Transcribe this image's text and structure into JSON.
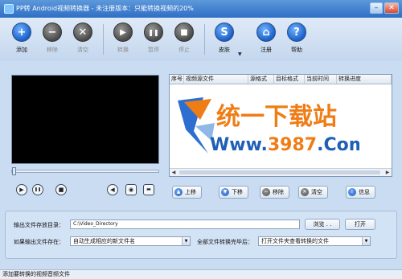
{
  "window": {
    "title": "PP转 Android视频转换器 - 未注册版本：只能转换视频的20%",
    "minimize_glyph": "–",
    "close_glyph": "✕"
  },
  "toolbar": {
    "add": {
      "label": "添加",
      "icon": "plus-icon",
      "glyph": "+"
    },
    "remove": {
      "label": "移除",
      "icon": "minus-icon",
      "glyph": "−"
    },
    "clear": {
      "label": "清空",
      "icon": "x-icon",
      "glyph": "✕"
    },
    "convert": {
      "label": "转换",
      "icon": "play-icon",
      "glyph": "▶"
    },
    "pause": {
      "label": "暂停",
      "icon": "pause-icon",
      "glyph": "❚❚"
    },
    "stop": {
      "label": "停止",
      "icon": "stop-icon",
      "glyph": "■"
    },
    "skin": {
      "label": "皮肤",
      "icon": "skin-s-icon",
      "glyph": "S"
    },
    "register": {
      "label": "注册",
      "icon": "home-icon",
      "glyph": "⌂"
    },
    "help": {
      "label": "帮助",
      "icon": "question-icon",
      "glyph": "?"
    }
  },
  "player": {
    "play_glyph": "▶",
    "pause_glyph": "❚❚",
    "stop_glyph": "■",
    "volume_glyph": "◀",
    "snapshot_glyph": "◉",
    "folder_glyph": "▬"
  },
  "file_list": {
    "columns": [
      "序号",
      "视频源文件",
      "源格式",
      "目标格式",
      "当前时间",
      "转换进度"
    ],
    "rows": [],
    "watermark": {
      "brand": "统一下载站",
      "url_prefix": "Www.",
      "url_number": "3987",
      "url_suffix": ".Com"
    }
  },
  "list_actions": {
    "move_up": {
      "label": "上移",
      "glyph": "▲"
    },
    "move_down": {
      "label": "下移",
      "glyph": "▼"
    },
    "remove": {
      "label": "移除",
      "glyph": "−"
    },
    "clear": {
      "label": "清空",
      "glyph": "✕"
    },
    "info": {
      "label": "信息",
      "glyph": "i"
    }
  },
  "settings": {
    "output_dir_label": "输出文件存放目录：",
    "output_dir_value": "C:\\Video_Directory",
    "browse_label": "浏览 . .",
    "open_label": "打开",
    "if_exists_label": "如果输出文件存在：",
    "if_exists_value": "自动生成相应的新文件名",
    "after_convert_label": "全部文件转换完毕后：",
    "after_convert_value": "打开文件夹查看转换的文件"
  },
  "status": {
    "text": "添加要转换的视频音频文件"
  },
  "colors": {
    "accent": "#1b5fc9",
    "watermark_orange": "#ef7d16",
    "watermark_blue": "#1f5fb6"
  }
}
